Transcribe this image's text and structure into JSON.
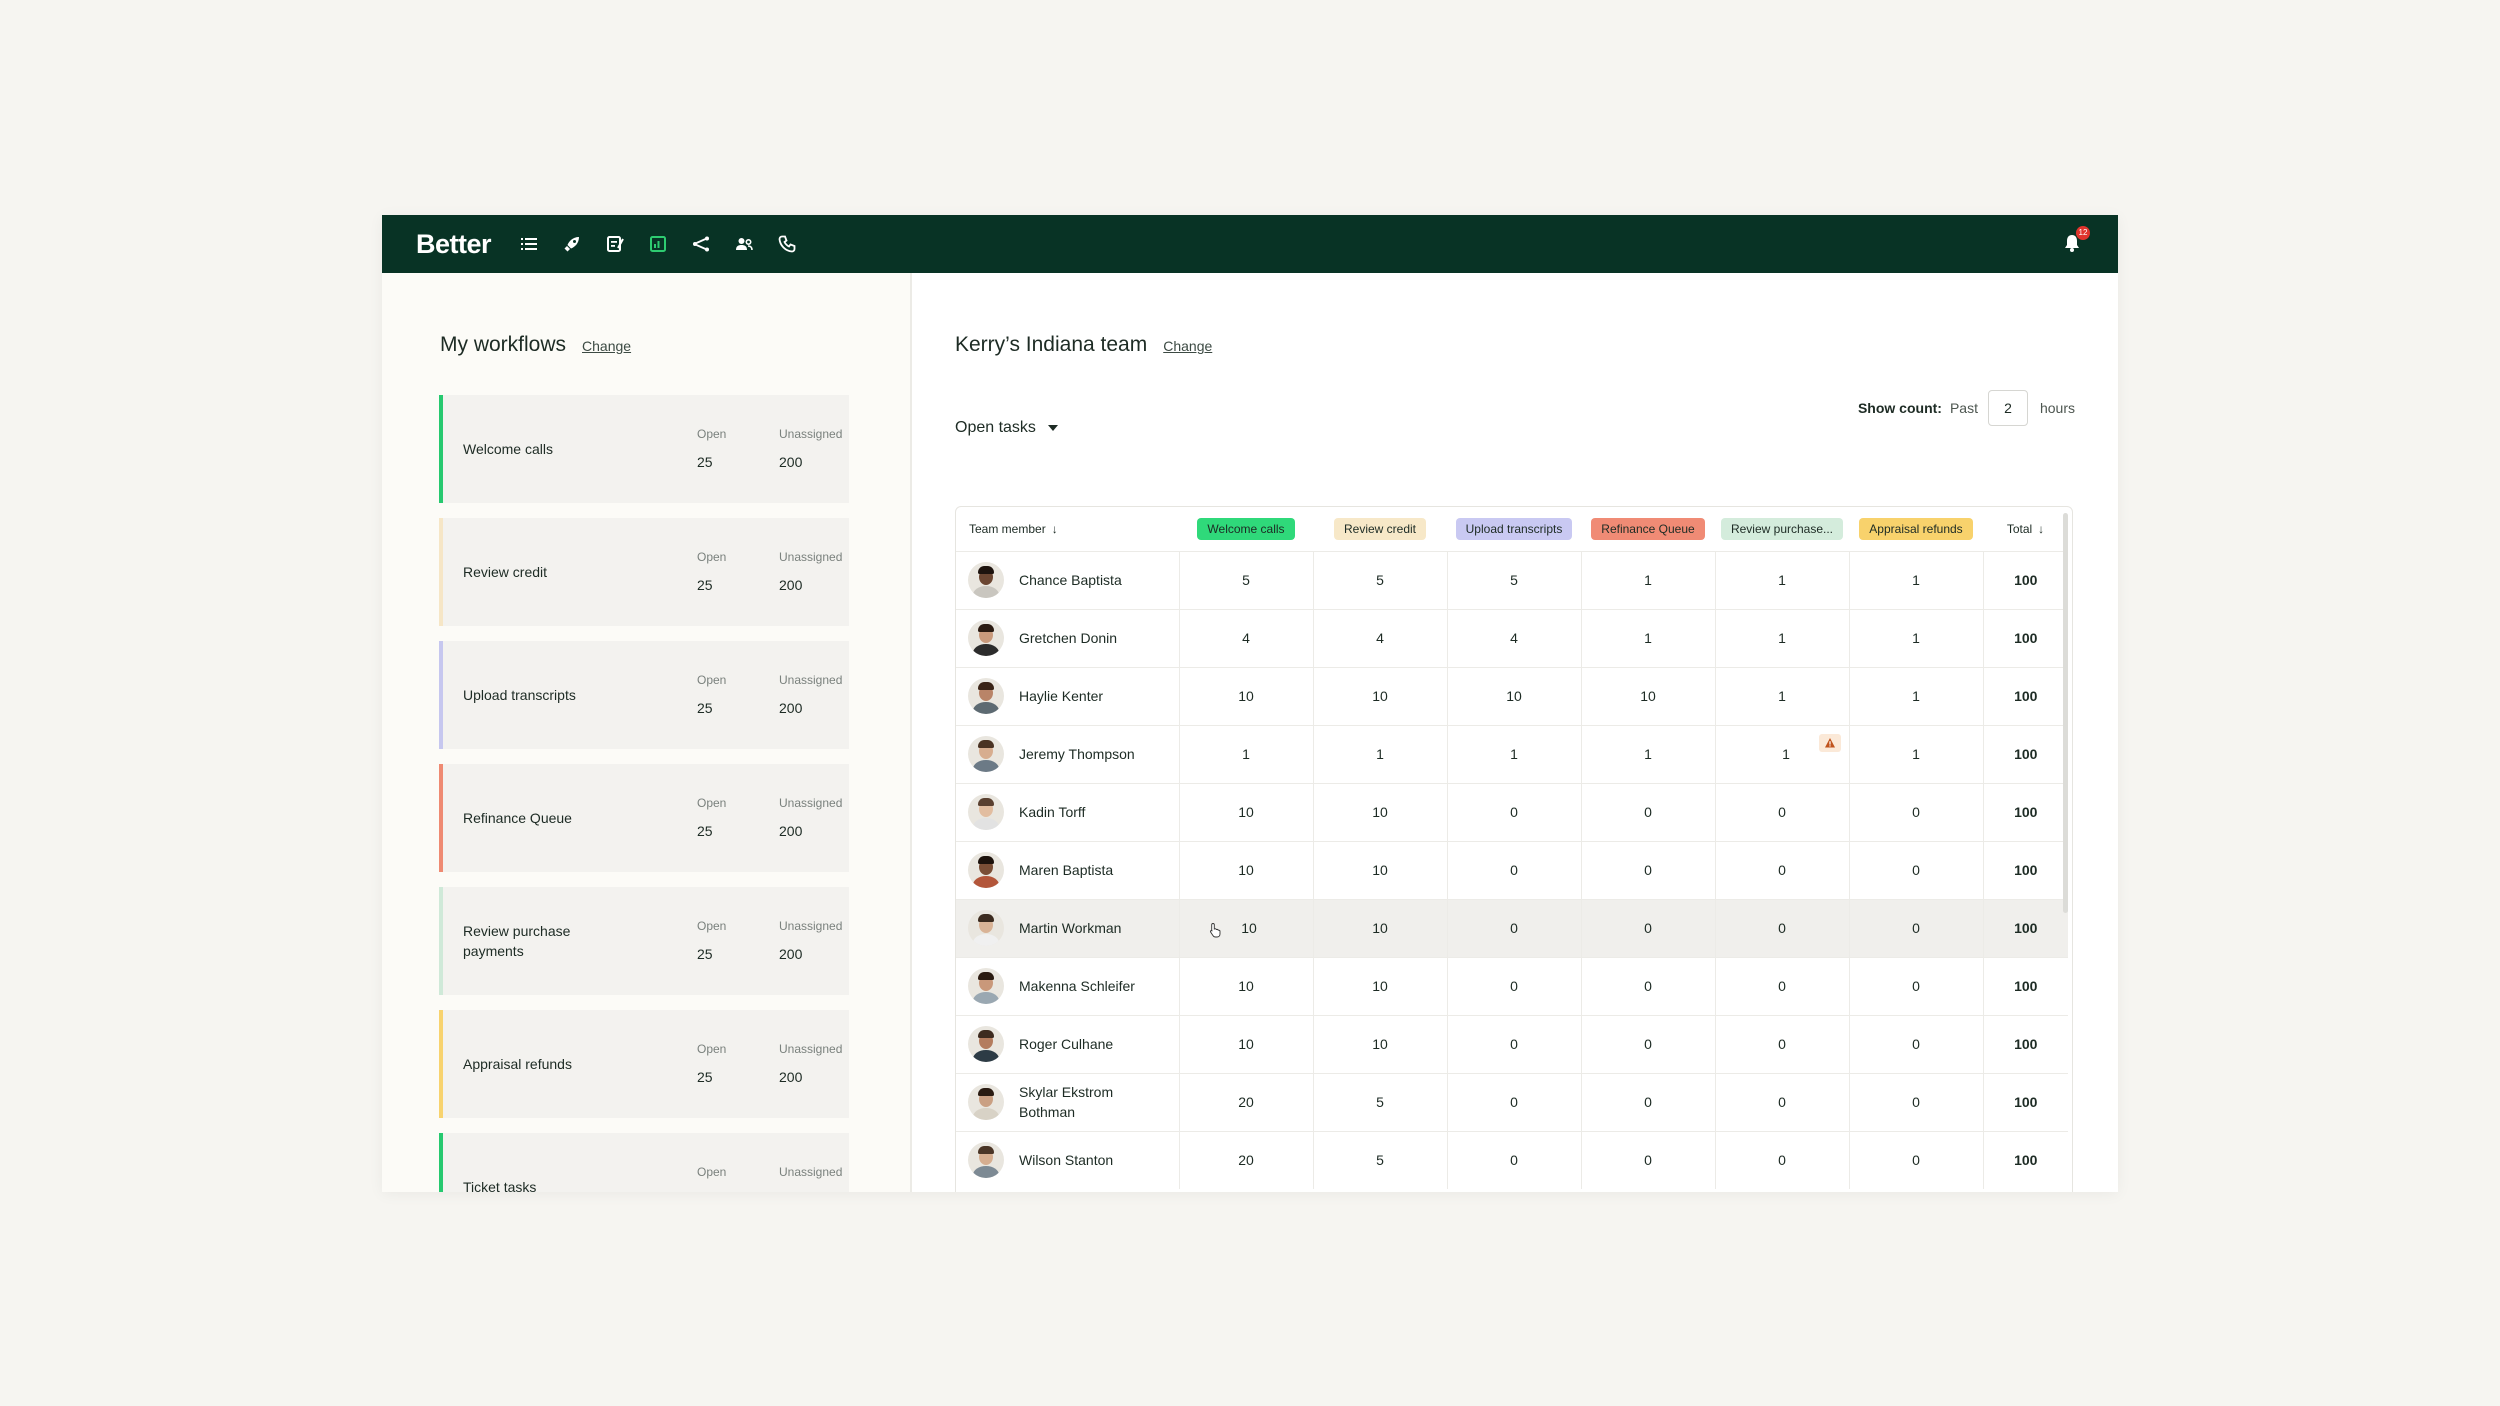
{
  "app": {
    "logo": "Better",
    "nav_icons": [
      "list-icon",
      "rocket-icon",
      "checklist-icon",
      "dashboard-icon",
      "workflow-icon",
      "team-icon",
      "phone-icon"
    ],
    "notification_count": "12",
    "colors": {
      "topbar": "#083325",
      "active_icon": "#2ecc71"
    }
  },
  "left": {
    "title": "My workflows",
    "change_label": "Change",
    "open_label": "Open",
    "unassigned_label": "Unassigned",
    "workflows": [
      {
        "name": "Welcome calls",
        "open": "25",
        "unassigned": "200",
        "color": "#26c96f"
      },
      {
        "name": "Review credit",
        "open": "25",
        "unassigned": "200",
        "color": "#f6e6c6"
      },
      {
        "name": "Upload transcripts",
        "open": "25",
        "unassigned": "200",
        "color": "#c6c7ef"
      },
      {
        "name": "Refinance Queue",
        "open": "25",
        "unassigned": "200",
        "color": "#ef8a72"
      },
      {
        "name": "Review purchase payments",
        "open": "25",
        "unassigned": "200",
        "color": "#cfe9d8"
      },
      {
        "name": "Appraisal refunds",
        "open": "25",
        "unassigned": "200",
        "color": "#f8d36e"
      },
      {
        "name": "Ticket tasks",
        "open": "",
        "unassigned": "",
        "color": "#26c96f"
      }
    ]
  },
  "right": {
    "title": "Kerry’s Indiana team",
    "change_label": "Change",
    "view_select": "Open tasks",
    "show_count_label": "Show count:",
    "past_label": "Past",
    "hours_value": "2",
    "hours_label": "hours",
    "table": {
      "member_header": "Team member",
      "total_header": "Total",
      "workflow_columns": [
        {
          "label": "Welcome calls",
          "color": "#2fd97a"
        },
        {
          "label": "Review credit",
          "color": "#f7e8c8"
        },
        {
          "label": "Upload transcripts",
          "color": "#c9c9f2"
        },
        {
          "label": "Refinance Queue",
          "color": "#f08b75"
        },
        {
          "label": "Review purchase...",
          "color": "#d4ecdc"
        },
        {
          "label": "Appraisal refunds",
          "color": "#f8d26c"
        }
      ],
      "rows": [
        {
          "name": "Chance Baptista",
          "values": [
            "5",
            "5",
            "5",
            "1",
            "1",
            "1"
          ],
          "total": "100"
        },
        {
          "name": "Gretchen Donin",
          "values": [
            "4",
            "4",
            "4",
            "1",
            "1",
            "1"
          ],
          "total": "100"
        },
        {
          "name": "Haylie Kenter",
          "values": [
            "10",
            "10",
            "10",
            "10",
            "1",
            "1"
          ],
          "total": "100"
        },
        {
          "name": "Jeremy Thompson",
          "values": [
            "1",
            "1",
            "1",
            "1",
            "1",
            "1"
          ],
          "total": "100",
          "warning_col": 4
        },
        {
          "name": "Kadin Torff",
          "values": [
            "10",
            "10",
            "0",
            "0",
            "0",
            "0"
          ],
          "total": "100"
        },
        {
          "name": "Maren Baptista",
          "values": [
            "10",
            "10",
            "0",
            "0",
            "0",
            "0"
          ],
          "total": "100"
        },
        {
          "name": "Martin Workman",
          "values": [
            "10",
            "10",
            "0",
            "0",
            "0",
            "0"
          ],
          "total": "100",
          "hovered": true
        },
        {
          "name": "Makenna Schleifer",
          "values": [
            "10",
            "10",
            "0",
            "0",
            "0",
            "0"
          ],
          "total": "100"
        },
        {
          "name": "Roger Culhane",
          "values": [
            "10",
            "10",
            "0",
            "0",
            "0",
            "0"
          ],
          "total": "100"
        },
        {
          "name": "Skylar Ekstrom Bothman",
          "values": [
            "20",
            "5",
            "0",
            "0",
            "0",
            "0"
          ],
          "total": "100"
        },
        {
          "name": "Wilson Stanton",
          "values": [
            "20",
            "5",
            "0",
            "0",
            "0",
            "0"
          ],
          "total": "100"
        }
      ]
    }
  }
}
